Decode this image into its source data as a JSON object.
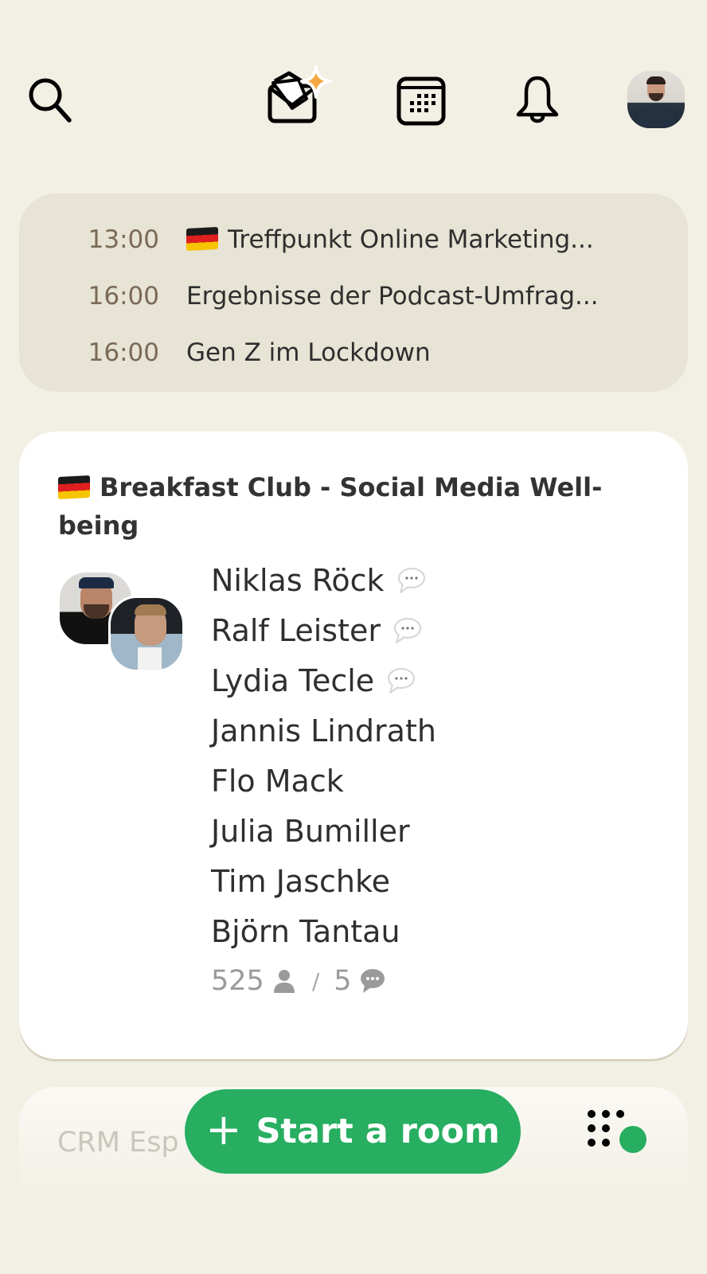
{
  "topbar": {
    "icons": {
      "search": "search-icon",
      "invite": "envelope-sparkle-icon",
      "calendar": "calendar-icon",
      "notifications": "bell-icon",
      "profile": "profile-avatar"
    },
    "accent_color": "#f5a742"
  },
  "upcoming": {
    "events": [
      {
        "time": "13:00",
        "flag": "de",
        "title": "Treffpunkt Online Marketing..."
      },
      {
        "time": "16:00",
        "flag": "",
        "title": "Ergebnisse der Podcast-Umfrag..."
      },
      {
        "time": "16:00",
        "flag": "",
        "title": "Gen Z im Lockdown"
      }
    ]
  },
  "room": {
    "flag": "de",
    "title": "Breakfast Club - Social Media Well-being",
    "speakers": [
      {
        "name": "Niklas Röck",
        "speaking_badge": true
      },
      {
        "name": "Ralf Leister",
        "speaking_badge": true
      },
      {
        "name": "Lydia Tecle",
        "speaking_badge": true
      },
      {
        "name": "Jannis Lindrath",
        "speaking_badge": false
      },
      {
        "name": "Flo Mack",
        "speaking_badge": false
      },
      {
        "name": "Julia Bumiller",
        "speaking_badge": false
      },
      {
        "name": "Tim Jaschke",
        "speaking_badge": false
      },
      {
        "name": "Björn Tantau",
        "speaking_badge": false
      }
    ],
    "listener_count": "525",
    "separator": "/",
    "speaker_count": "5"
  },
  "next_room": {
    "title": "CRM Esp"
  },
  "actions": {
    "start_room_label": "Start a room",
    "start_room_color": "#27ae60"
  }
}
